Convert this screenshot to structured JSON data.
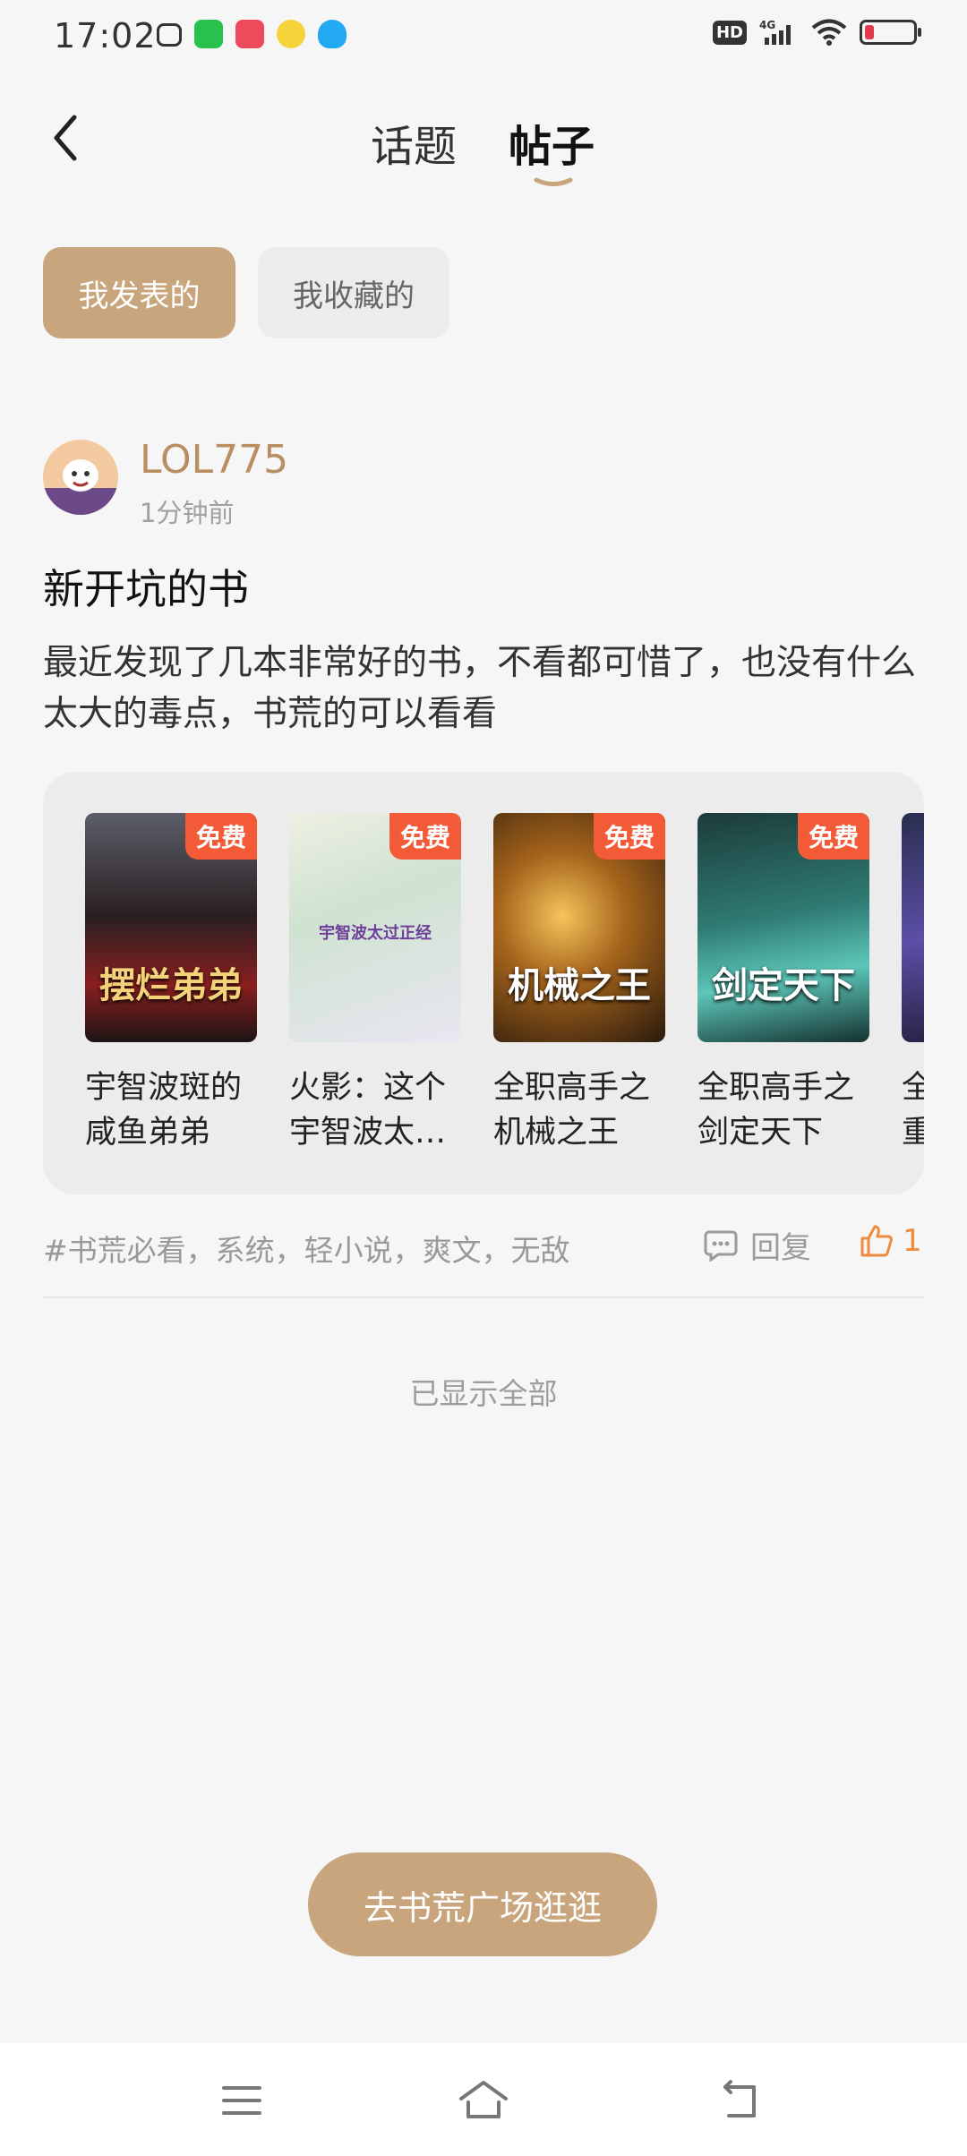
{
  "status_bar": {
    "time": "17:02"
  },
  "header": {
    "tabs": [
      {
        "label": "话题"
      },
      {
        "label": "帖子"
      }
    ]
  },
  "filters": {
    "mine": "我发表的",
    "favorites": "我收藏的"
  },
  "post": {
    "username": "LOL775",
    "time": "1分钟前",
    "title": "新开坑的书",
    "body": "最近发现了几本非常好的书，不看都可惜了，也没有什么太大的毒点，书荒的可以看看",
    "books": [
      {
        "name": "宇智波斑的\n咸鱼弟弟",
        "badge": "免费",
        "cover_title": "摆烂弟弟"
      },
      {
        "name": "火影：这个\n宇智波太…",
        "badge": "免费",
        "cover_title": "宇智波太过正经"
      },
      {
        "name": "全职高手之\n机械之王",
        "badge": "免费",
        "cover_title": "机械之王"
      },
      {
        "name": "全职高手之\n剑定天下",
        "badge": "免费",
        "cover_title": "剑定天下"
      },
      {
        "name": "全\n重",
        "badge": "",
        "cover_title": ""
      }
    ],
    "tags": "#书荒必看，系统，轻小说，爽文，无敌",
    "reply_label": "回复",
    "like_count": "1"
  },
  "list_end": "已显示全部",
  "cta_label": "去书荒广场逛逛",
  "colors": {
    "accent": "#c9a57d",
    "username": "#b98f61",
    "badge": "#f35a38",
    "like": "#f08a3c"
  }
}
